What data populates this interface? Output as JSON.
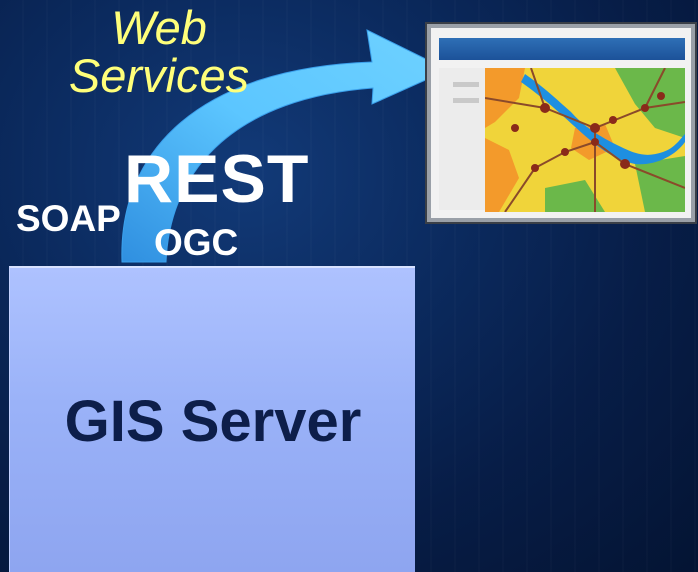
{
  "diagram": {
    "web_services_line1": "Web",
    "web_services_line2": "Services",
    "protocol_rest": "REST",
    "protocol_soap": "SOAP",
    "protocol_ogc": "OGC",
    "server_label": "GIS Server"
  },
  "colors": {
    "background": "#0b2a5e",
    "web_services_text": "#ffff7a",
    "arrow": "#5bc8ff",
    "server_box": "#9ab2f8",
    "server_text": "#0d1e4a"
  },
  "icons": [
    "curved-arrow-icon",
    "map-window-icon"
  ]
}
